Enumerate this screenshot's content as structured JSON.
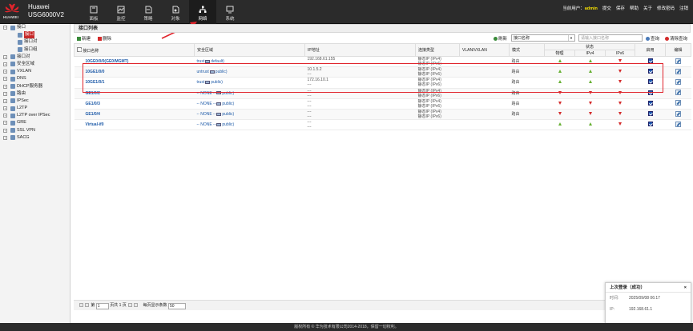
{
  "brand": {
    "company": "Huawei",
    "product": "USG6000V2",
    "logo_word": "HUAWEI"
  },
  "nav": {
    "items": [
      {
        "label": "面板",
        "icon": "dashboard-icon"
      },
      {
        "label": "监控",
        "icon": "monitor-icon"
      },
      {
        "label": "策略",
        "icon": "policy-icon"
      },
      {
        "label": "对象",
        "icon": "object-icon"
      },
      {
        "label": "网络",
        "icon": "network-icon",
        "active": true
      },
      {
        "label": "系统",
        "icon": "system-icon"
      }
    ]
  },
  "topbar": {
    "user_prefix": "当前用户：",
    "user": "admin",
    "submit": "提交",
    "save": "保存",
    "help": "帮助",
    "about": "关于",
    "change_password": "修改密码",
    "logout": "注销"
  },
  "sidebar": {
    "items": [
      {
        "label": "接口",
        "level": 0,
        "expanded": true
      },
      {
        "label": "接口",
        "level": 1,
        "selected": true
      },
      {
        "label": "接口对",
        "level": 1
      },
      {
        "label": "接口组",
        "level": 1
      },
      {
        "label": "接口对",
        "level": 0
      },
      {
        "label": "安全区域",
        "level": 0
      },
      {
        "label": "VXLAN",
        "level": 0
      },
      {
        "label": "DNS",
        "level": 0,
        "expandable": true
      },
      {
        "label": "DHCP服务器",
        "level": 0,
        "expandable": true
      },
      {
        "label": "路由",
        "level": 0,
        "expandable": true
      },
      {
        "label": "IPSec",
        "level": 0,
        "expandable": true
      },
      {
        "label": "L2TP",
        "level": 0,
        "expandable": true
      },
      {
        "label": "L2TP over IPSec",
        "level": 0
      },
      {
        "label": "GRE",
        "level": 0,
        "expandable": true
      },
      {
        "label": "SSL VPN",
        "level": 0,
        "expandable": true
      },
      {
        "label": "SACG",
        "level": 0,
        "expandable": true
      }
    ]
  },
  "main": {
    "title": "接口列表",
    "toolbar": {
      "add": "新建",
      "delete": "删除",
      "refresh": "刷新",
      "search_field": "接口名称",
      "search_placeholder": "请输入接口名称",
      "query": "查询",
      "clear_query": "清除查询"
    },
    "columns": {
      "name": "接口名称",
      "zone": "安全区域",
      "ip": "IP地址",
      "conn": "连接类型",
      "vlan": "VLAN/VXLAN",
      "mode": "模式",
      "status": "状态",
      "physical": "物理",
      "ipv4": "IPv4",
      "ipv6": "IPv6",
      "enable": "启用",
      "edit": "编辑"
    },
    "rows": [
      {
        "name": "10GE0/0/0(GE0/MGMT)",
        "zone": "trust",
        "zone_vsys": "default)",
        "ip1": "192.168.61.155",
        "ip2": "---",
        "conn1": "静态IP (IPv4)",
        "conn2": "静态IP (IPv6)",
        "mode": "路由",
        "phys": "up",
        "v4": "up",
        "v6": "down"
      },
      {
        "name": "10GE1/0/0",
        "zone": "untrust",
        "zone_vsys": "public)",
        "ip1": "10.1.5.2",
        "ip2": "---",
        "conn1": "静态IP (IPv4)",
        "conn2": "静态IP (IPv6)",
        "mode": "路由",
        "phys": "up",
        "v4": "up",
        "v6": "down"
      },
      {
        "name": "10GE1/0/1",
        "zone": "trust",
        "zone_vsys": "public)",
        "ip1": "172.16.10.1",
        "ip2": "---",
        "conn1": "静态IP (IPv4)",
        "conn2": "静态IP (IPv6)",
        "mode": "路由",
        "phys": "up",
        "v4": "up",
        "v6": "down"
      },
      {
        "name": "GE1/0/2",
        "zone": "-- NONE --",
        "zone_vsys": "public)",
        "ip1": "---",
        "ip2": "---",
        "conn1": "静态IP (IPv4)",
        "conn2": "静态IP (IPv6)",
        "mode": "路由",
        "phys": "down",
        "v4": "down",
        "v6": "down"
      },
      {
        "name": "GE1/0/3",
        "zone": "-- NONE --",
        "zone_vsys": "public)",
        "ip1": "---",
        "ip2": "---",
        "conn1": "静态IP (IPv4)",
        "conn2": "静态IP (IPv6)",
        "mode": "路由",
        "phys": "down",
        "v4": "down",
        "v6": "down"
      },
      {
        "name": "GE1/0/4",
        "zone": "-- NONE --",
        "zone_vsys": "public)",
        "ip1": "---",
        "ip2": "---",
        "conn1": "静态IP (IPv4)",
        "conn2": "静态IP (IPv6)",
        "mode": "路由",
        "phys": "down",
        "v4": "down",
        "v6": "down"
      },
      {
        "name": "Virtual-if0",
        "zone": "-- NONE --",
        "zone_vsys": "public)",
        "ip1": "---",
        "ip2": "---",
        "conn1": "",
        "conn2": "",
        "mode": "",
        "phys": "up",
        "v4": "up",
        "v6": "down"
      }
    ],
    "pager": {
      "page_label": "第",
      "page_value": "1",
      "total": "页共 1 页",
      "per_page_label": "每页显示条数",
      "per_page": "50"
    }
  },
  "login_box": {
    "title": "上次登录（成功）",
    "close": "×",
    "time_label": "时间:",
    "time": "2025/09/08 06:17",
    "ip_label": "IP:",
    "ip": "192.168.61.1"
  },
  "footer": "版权所有 © 华为技术有限公司2014-2018，保留一切权利。",
  "colors": {
    "topbar": "#2b2b2b",
    "accent_red": "#e0242c",
    "link_blue": "#1d5aa8",
    "status_up": "#67b033",
    "status_down": "#d32a2a"
  }
}
